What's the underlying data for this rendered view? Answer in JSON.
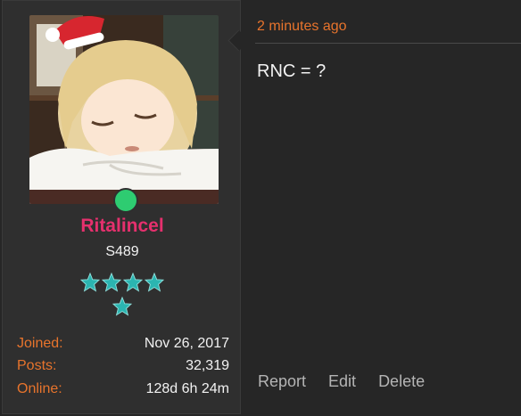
{
  "user": {
    "name": "Ritalincel",
    "title": "S489",
    "rank_stars": 5,
    "online": true,
    "status_color": "#2ecc71",
    "name_color": "#e5306d"
  },
  "stats": [
    {
      "label": "Joined:",
      "value": "Nov 26, 2017"
    },
    {
      "label": "Posts:",
      "value": "32,319"
    },
    {
      "label": "Online:",
      "value": "128d 6h 24m"
    }
  ],
  "post": {
    "timestamp": "2 minutes ago",
    "message": "RNC = ?",
    "actions": {
      "report": "Report",
      "edit": "Edit",
      "delete": "Delete"
    }
  },
  "colors": {
    "accent": "#e8742c",
    "star": "#2bb5b1",
    "background": "#262626",
    "panel": "#2f2f2f"
  }
}
